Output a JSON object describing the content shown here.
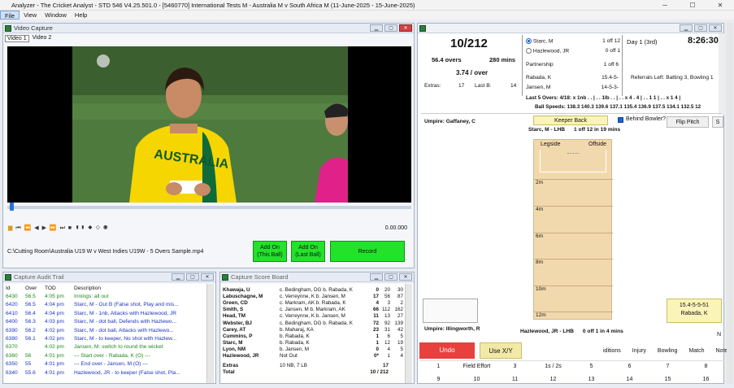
{
  "window": {
    "title": "Analyzer - The Cricket Analyst - STD 546 V4.25.501.0 - [5460770] International Tests M - Australia M v South Africa M (11-June-2025 - 15-June-2025)",
    "controls": [
      "─",
      "☐",
      "✕"
    ]
  },
  "menu": [
    "File",
    "View",
    "Window",
    "Help"
  ],
  "video": {
    "panel_title": "Video Capture",
    "tabs": [
      "Video 1",
      "Video 2"
    ],
    "timecode": "0.00.000",
    "file_path": "C:\\Cutting Room\\Australia U19 W v West Indies U19W - 5 Overs Sample.mp4",
    "add_on_this": "Add On\n(This Ball)",
    "add_on_last": "Add On\n(Last Ball)",
    "record": "Record",
    "jersey_text": "AUSTRALIA"
  },
  "audit": {
    "panel_title": "Capture Audit Trail",
    "headers": [
      "Id",
      "Over",
      "TOD",
      "Description"
    ],
    "rows": [
      {
        "id": "6430",
        "over": "56.5",
        "tod": "4:05 pm",
        "desc": "Innings: all out",
        "color": "#1e8a1e"
      },
      {
        "id": "6420",
        "over": "56.5",
        "tod": "4:04 pm",
        "desc": "Starc, M - Out B (False shot, Play and mis...",
        "color": "#1c35c4"
      },
      {
        "id": "6410",
        "over": "56.4",
        "tod": "4:04 pm",
        "desc": "Starc, M - 1nb, Attacks with Hazlewood, JR",
        "color": "#1c35c4"
      },
      {
        "id": "6400",
        "over": "56.3",
        "tod": "4:03 pm",
        "desc": "Starc, M - dot ball, Defends with Hazlewo...",
        "color": "#1c35c4"
      },
      {
        "id": "6390",
        "over": "56.2",
        "tod": "4:02 pm",
        "desc": "Starc, M - dot ball, Attacks with Hazlewo...",
        "color": "#1c35c4"
      },
      {
        "id": "6380",
        "over": "56.1",
        "tod": "4:02 pm",
        "desc": "Starc, M - to keeper, No shot with Hazlew...",
        "color": "#1c35c4"
      },
      {
        "id": "6370",
        "over": "",
        "tod": "4:02 pm",
        "desc": "Jansen, M: switch to round the wicket",
        "color": "#1e8a1e"
      },
      {
        "id": "6360",
        "over": "56",
        "tod": "4:01 pm",
        "desc": "--- Start over - Rabada, K (O) ---",
        "color": "#1e8a1e"
      },
      {
        "id": "6350",
        "over": "55",
        "tod": "4:01 pm",
        "desc": "--- End over - Jansen, M (O) ---",
        "color": "#1c35c4"
      },
      {
        "id": "6340",
        "over": "55.6",
        "tod": "4:01 pm",
        "desc": "Hazlewood, JR - to keeper (False shot, Pla...",
        "color": "#1c35c4"
      }
    ]
  },
  "scoreboard": {
    "panel_title": "Capture Score Board",
    "rows": [
      {
        "name": "Khawaja, U",
        "how": "c. Bedingham, DG b. Rabada, K",
        "r": "0",
        "b": "20",
        "m": "30"
      },
      {
        "name": "Labuschagne, M",
        "how": "c. Verreynne, K b. Jansen, M",
        "r": "17",
        "b": "56",
        "m": "87"
      },
      {
        "name": "Green, CD",
        "how": "c. Markram, AK b. Rabada, K",
        "r": "4",
        "b": "3",
        "m": "2"
      },
      {
        "name": "Smith, S",
        "how": "c. Jansen, M b. Markram, AK",
        "r": "66",
        "b": "112",
        "m": "162"
      },
      {
        "name": "Head, TM",
        "how": "c. Verreynne, K b. Jansen, M",
        "r": "11",
        "b": "13",
        "m": "27"
      },
      {
        "name": "Webster, BJ",
        "how": "c. Bedingham, DG b. Rabada, K",
        "r": "72",
        "b": "92",
        "m": "139"
      },
      {
        "name": "Carey, AT",
        "how": "b. Maharaj, KA",
        "r": "23",
        "b": "31",
        "m": "42"
      },
      {
        "name": "Cummins, P",
        "how": "b. Rabada, K",
        "r": "1",
        "b": "6",
        "m": "5"
      },
      {
        "name": "Starc, M",
        "how": "b. Rabada, K",
        "r": "1",
        "b": "12",
        "m": "19"
      },
      {
        "name": "Lyon, NM",
        "how": "b. Jansen, M",
        "r": "0",
        "b": "4",
        "m": "5"
      },
      {
        "name": "Hazlewood, JR",
        "how": "Not Out",
        "r": "0*",
        "b": "1",
        "m": "4"
      }
    ],
    "extras_label": "Extras",
    "extras_detail": "10 NB, 7 LB",
    "extras_value": "17",
    "total_label": "Total",
    "total_value": "10 / 212"
  },
  "right": {
    "score": "10/212",
    "overs": "56.4 overs",
    "mins": "280 mins",
    "run_rate": "3.74 / over",
    "extras_label": "Extras:",
    "extras_value": "17",
    "last_b_label": "Last B:",
    "last_b_value": "14",
    "batters": [
      {
        "name": "Starc, M",
        "stat": "1 off 12",
        "selected": true
      },
      {
        "name": "Hazlewood, JR",
        "stat": "0 off 1",
        "selected": false
      }
    ],
    "partnership_label": "Partnership",
    "partnership_value": "1 off 6",
    "bowlers": [
      {
        "name": "Rabada, K",
        "fig": "15.4-5-"
      },
      {
        "name": "Jansen, M",
        "fig": "14-5-3-"
      }
    ],
    "day": "Day 1 (3rd)",
    "clock": "8:26:30",
    "referrals": "Referrals Left: Batting 3, Bowling 1",
    "last5": "Last 5 Overs:  4/18: x 1nb . . | . . 1lb . . | . . x 4 . 4 | . . 1 1 | . . x 1 4 |",
    "speeds": "Ball Speeds:  138.3 140.3 139.6 137.1 135.4  136.9 137.5 134.1 132.5 12",
    "umpire_top": "Umpire: Gaffaney, C",
    "keeper_back": "Keeper Back",
    "behind_bowler": "Behind Bowler?",
    "flip_pitch": "Flip Pitch",
    "s_btn": "S",
    "striker_line": "Starc, M - LHB      1 off 12 in 19 mins",
    "pitch_leg": "Legside",
    "pitch_off": "Offside",
    "pitch_marks": [
      "2m",
      "4m",
      "6m",
      "8m",
      "10m",
      "12m"
    ],
    "bowler_box": "15.4-5-5-51\nRabada, K",
    "n_label": "N",
    "umpire_bottom": "Umpire: Illingworth, R",
    "nonstriker_line": "Hazlewood, JR - LHB      0 off 1 in 4 mins",
    "undo": "Undo",
    "use_xy": "Use X/Y",
    "tabs": [
      "iditions",
      "Injury",
      "Bowling",
      "Match",
      "Note"
    ],
    "fielder_row": [
      "1",
      "Field Effort",
      "3",
      "1s / 2s",
      "5",
      "6",
      "7",
      "8"
    ],
    "fielder_row2": [
      "9",
      "10",
      "11",
      "12",
      "13",
      "14",
      "15",
      "16"
    ]
  },
  "colors": {
    "record_green": "#22e22a",
    "undo_red": "#e8403c",
    "use_xy_yellow": "#f3e9a6",
    "pitch": "#f2d9ad"
  }
}
